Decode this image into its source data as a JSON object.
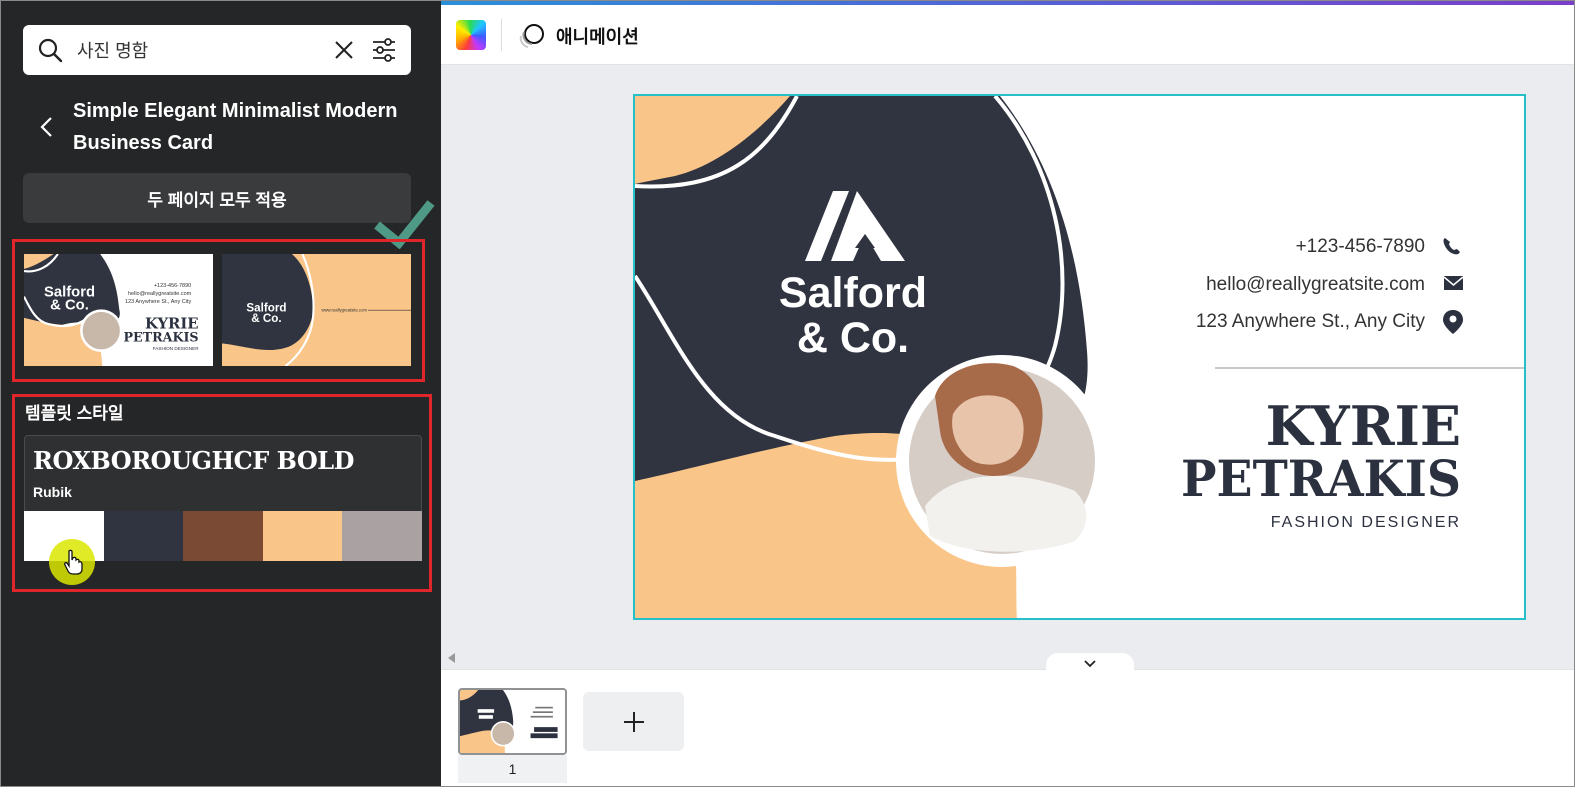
{
  "search": {
    "query": "사진 명함"
  },
  "template": {
    "title": "Simple Elegant Minimalist Modern Business Card",
    "apply_button": "두 페이지 모두 적용"
  },
  "style": {
    "heading": "템플릿 스타일",
    "heading_font": "ROXBOROUGHCF BOLD",
    "body_font": "Rubik",
    "palette": [
      "#ffffff",
      "#2f3440",
      "#7a4a35",
      "#f9c589",
      "#aaa2a2"
    ]
  },
  "toolbar": {
    "animation_label": "애니메이션"
  },
  "card": {
    "company_line1": "Salford",
    "company_line2": "& Co.",
    "phone": "+123-456-7890",
    "email": "hello@reallygreatsite.com",
    "address": "123 Anywhere St., Any City",
    "name_line1": "KYRIE",
    "name_line2": "PETRAKIS",
    "role": "FASHION DESIGNER"
  },
  "thumbs": {
    "p1_company_line1": "Salford",
    "p1_company_line2": "& Co.",
    "p1_phone": "+123-456-7890",
    "p1_email": "hello@reallygreatsite.com",
    "p1_address": "123 Anywhere St., Any City",
    "p1_name_line1": "KYRIE",
    "p1_name_line2": "PETRAKIS",
    "p1_role": "FASHION DESIGNER",
    "p2_company_line1": "Salford",
    "p2_company_line2": "& Co.",
    "p2_website": "www.reallygreatsite.com"
  },
  "pages": {
    "page_number": "1"
  },
  "colors": {
    "accent_selection": "#25c0c8",
    "highlight_border": "#e0262b",
    "check_green": "#4f9a86"
  }
}
